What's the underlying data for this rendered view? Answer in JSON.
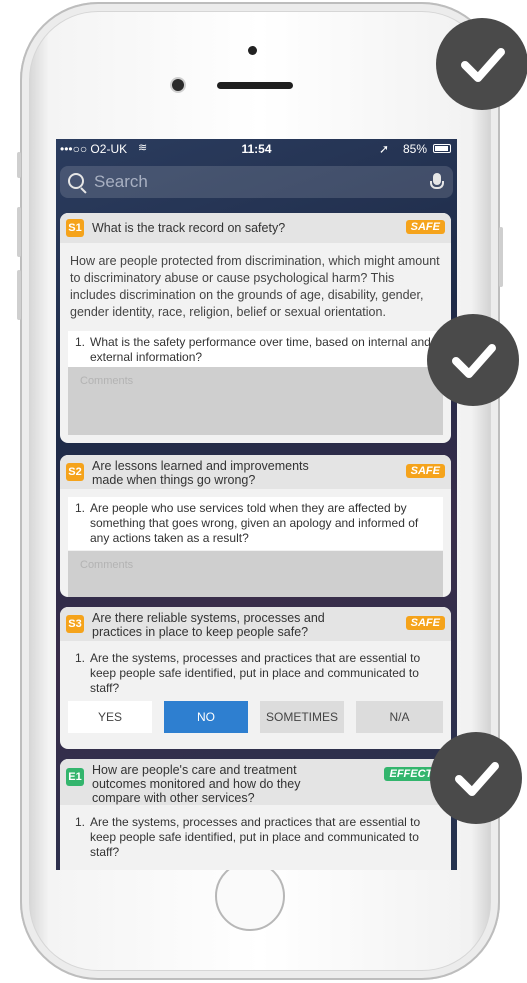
{
  "status_bar": {
    "carrier": "•••○○ O2-UK",
    "time": "11:54",
    "battery": "85%"
  },
  "search": {
    "placeholder": "Search"
  },
  "cards": [
    {
      "badge": "S1",
      "title": "What is the track record on safety?",
      "tag": "SAFE",
      "body": "How are people protected from discrimination, which might amount to discriminatory abuse or cause psychological harm? This includes discrimination on the grounds of age, disability, gender, gender identity, race, religion, belief or sexual orientation.",
      "sub_num": "1.",
      "sub_text": "What is the safety performance over time, based on internal and external information?",
      "comments_placeholder": "Comments"
    },
    {
      "badge": "S2",
      "title": "Are lessons learned and improvements made when things go wrong?",
      "tag": "SAFE",
      "sub_num": "1.",
      "sub_text": "Are people who use services told when they are affected by something that goes wrong, given an apology and informed of any actions taken as a result?",
      "comments_placeholder": "Comments"
    },
    {
      "badge": "S3",
      "title": "Are there reliable systems, processes and practices in place to keep people safe?",
      "tag": "SAFE",
      "sub_num": "1.",
      "sub_text": "Are the systems, processes and practices that are essential to keep people safe identified, put in place and communicated to staff?",
      "options": [
        "YES",
        "NO",
        "SOMETIMES",
        "N/A"
      ],
      "selected": "NO"
    },
    {
      "badge": "E1",
      "title": "How are people's care and treatment outcomes monitored and how do they compare with other services?",
      "tag": "EFFECTIVE",
      "sub_num": "1.",
      "sub_text": "Are the systems, processes and practices that are essential to keep people safe identified, put in place and communicated to staff?"
    }
  ],
  "colors": {
    "safe": "#f5a31b",
    "effective": "#33b56d",
    "selected_option": "#2e7fd0",
    "check_circle": "#4a4a4a"
  },
  "icons": [
    "search-icon",
    "microphone-icon",
    "location-arrow-icon",
    "wifi-icon",
    "battery-icon",
    "checkmark-icon"
  ]
}
